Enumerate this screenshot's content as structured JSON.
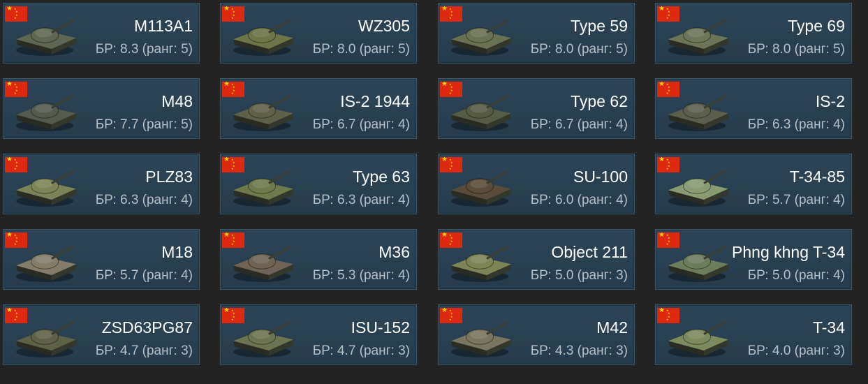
{
  "flag_icon": "china-flag-icon",
  "colors": {
    "background": "#242424",
    "card": "#2c4354",
    "card_border": "#3c586b",
    "name_text": "#ffffff",
    "br_text": "#b7c0c7",
    "flag_red": "#de2910",
    "flag_star": "#ffde00"
  },
  "vehicles": [
    {
      "name": "M113A1",
      "br": "БР: 8.3 (ранг: 5)",
      "icon": "spaa-tank-icon",
      "hull": "#5f6752"
    },
    {
      "name": "WZ305",
      "br": "БР: 8.0 (ранг: 5)",
      "icon": "spaa-tank-icon",
      "hull": "#6d7448"
    },
    {
      "name": "Type 59",
      "br": "БР: 8.0 (ранг: 5)",
      "icon": "medium-tank-icon",
      "hull": "#6a7153"
    },
    {
      "name": "Type 69",
      "br": "БР: 8.0 (ранг: 5)",
      "icon": "medium-tank-icon",
      "hull": "#6d7458"
    },
    {
      "name": "M48",
      "br": "БР: 7.7 (ранг: 5)",
      "icon": "medium-tank-icon",
      "hull": "#555a4f"
    },
    {
      "name": "IS-2 1944",
      "br": "БР: 6.7 (ранг: 4)",
      "icon": "heavy-tank-icon",
      "hull": "#5f6049"
    },
    {
      "name": "Type 62",
      "br": "БР: 6.7 (ранг: 4)",
      "icon": "light-tank-icon",
      "hull": "#565b44"
    },
    {
      "name": "IS-2",
      "br": "БР: 6.3 (ранг: 4)",
      "icon": "heavy-tank-icon",
      "hull": "#5c5f4e"
    },
    {
      "name": "PLZ83",
      "br": "БР: 6.3 (ранг: 4)",
      "icon": "spg-icon",
      "hull": "#7c8457"
    },
    {
      "name": "Type 63",
      "br": "БР: 6.3 (ранг: 4)",
      "icon": "light-tank-icon",
      "hull": "#6f7a4c"
    },
    {
      "name": "SU-100",
      "br": "БР: 6.0 (ранг: 4)",
      "icon": "tank-destroyer-icon",
      "hull": "#5a4c3a"
    },
    {
      "name": "T-34-85",
      "br": "БР: 5.7 (ранг: 4)",
      "icon": "medium-tank-icon",
      "hull": "#8a9a72"
    },
    {
      "name": "M18",
      "br": "БР: 5.7 (ранг: 4)",
      "icon": "tank-destroyer-icon",
      "hull": "#847d6a"
    },
    {
      "name": "M36",
      "br": "БР: 5.3 (ранг: 4)",
      "icon": "tank-destroyer-icon",
      "hull": "#6e6354"
    },
    {
      "name": "Object 211",
      "br": "БР: 5.0 (ранг: 3)",
      "icon": "light-tank-icon",
      "hull": "#7d8456"
    },
    {
      "name": "Phng khng T-34",
      "br": "БР: 5.0 (ранг: 4)",
      "icon": "spaa-tank-icon",
      "hull": "#6e7c5e"
    },
    {
      "name": "ZSD63PG87",
      "br": "БР: 4.7 (ранг: 3)",
      "icon": "spaa-tank-icon",
      "hull": "#5e6048"
    },
    {
      "name": "ISU-152",
      "br": "БР: 4.7 (ранг: 3)",
      "icon": "tank-destroyer-icon",
      "hull": "#6c7350"
    },
    {
      "name": "M42",
      "br": "БР: 4.3 (ранг: 3)",
      "icon": "spaa-tank-icon",
      "hull": "#7a7560"
    },
    {
      "name": "T-34",
      "br": "БР: 4.0 (ранг: 3)",
      "icon": "medium-tank-icon",
      "hull": "#7d8a5e"
    }
  ]
}
